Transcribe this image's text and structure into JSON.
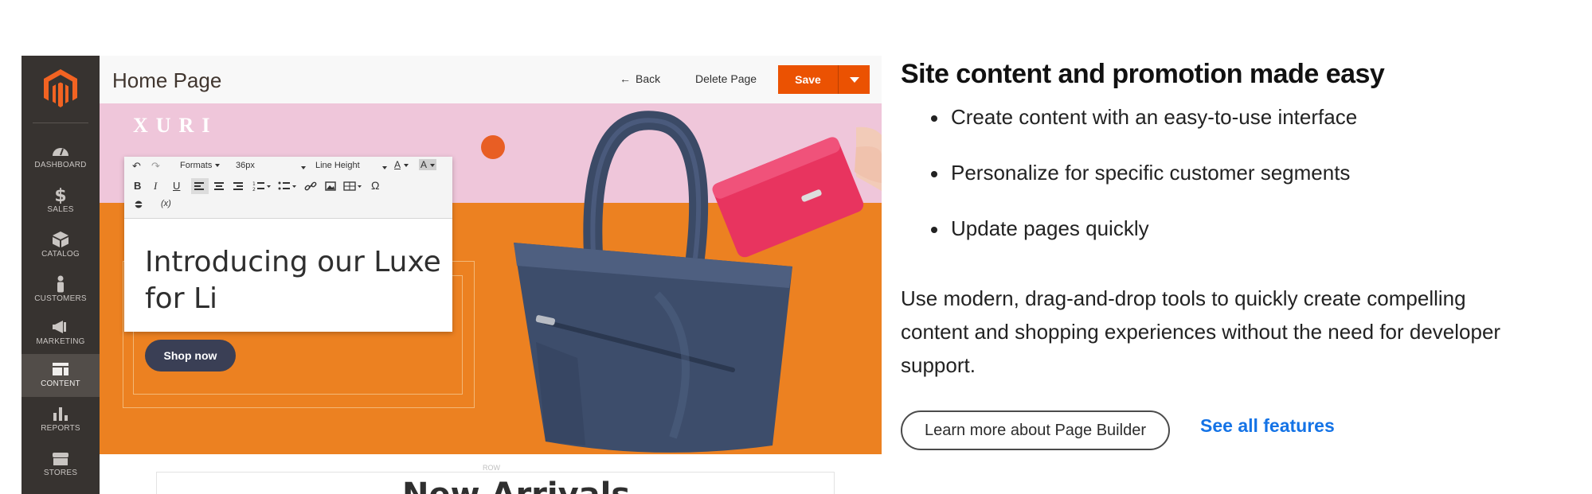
{
  "admin": {
    "page_title": "Home Page",
    "back_label": "Back",
    "delete_label": "Delete Page",
    "save_label": "Save",
    "nav": [
      {
        "label": "DASHBOARD",
        "icon": "dashboard-icon"
      },
      {
        "label": "SALES",
        "icon": "dollar-icon"
      },
      {
        "label": "CATALOG",
        "icon": "cube-icon"
      },
      {
        "label": "CUSTOMERS",
        "icon": "person-icon"
      },
      {
        "label": "MARKETING",
        "icon": "megaphone-icon"
      },
      {
        "label": "CONTENT",
        "icon": "layout-icon",
        "active": true
      },
      {
        "label": "REPORTS",
        "icon": "bar-chart-icon"
      },
      {
        "label": "STORES",
        "icon": "storefront-icon"
      }
    ]
  },
  "hero": {
    "brand": "XURI",
    "editor_text": "Introducing our Luxe for Li",
    "shop_label": "Shop now",
    "row_tag": "ROW",
    "below_heading": "New Arrivals"
  },
  "toolbar": {
    "formats": "Formats",
    "font_size": "36px",
    "line_height": "Line Height",
    "bold": "B",
    "italic": "I",
    "underline": "U",
    "omega": "Ω",
    "variable": "(x)",
    "color_letter": "A"
  },
  "copy": {
    "heading": "Site content and promotion made easy",
    "bullets": [
      "Create content with an easy-to-use interface",
      "Personalize for specific customer segments",
      "Update pages quickly"
    ],
    "description": "Use modern, drag-and-drop tools to quickly create compelling content and shopping experiences without the need for developer support.",
    "learn_more": "Learn more about Page Builder",
    "see_all": "See all features"
  },
  "colors": {
    "sidebar": "#373330",
    "accent_orange": "#eb5202",
    "hero_orange": "#ec8121",
    "hero_pink": "#efc6da",
    "link_blue": "#1473e6"
  }
}
